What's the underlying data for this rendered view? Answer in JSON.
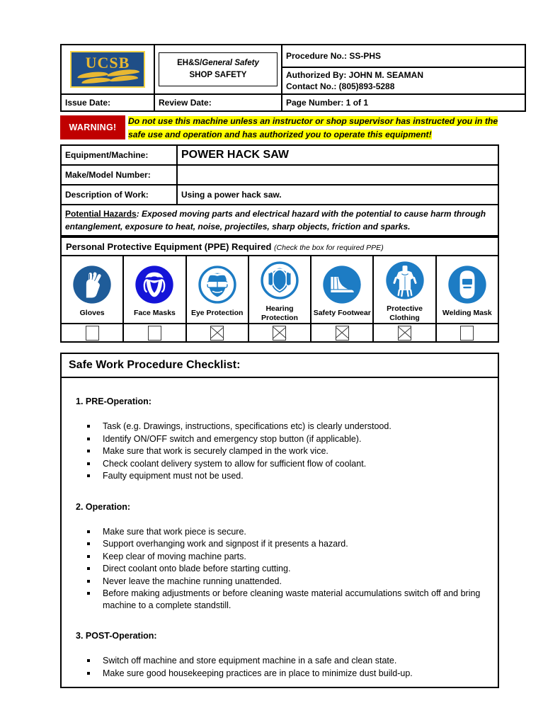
{
  "header": {
    "logo_text": "UCSB",
    "unit_line1": "EH&S/",
    "unit_line1_italic": "General Safety",
    "unit_line2": "SHOP SAFETY",
    "procedure_no": "Procedure No.: SS-PHS",
    "authorized_by": "Authorized By: JOHN M. SEAMAN",
    "contact_no": "Contact  No.: (805)893-5288",
    "issue_date": "Issue Date:",
    "review_date": "Review Date:",
    "page_number": "Page Number: 1 of 1"
  },
  "warning": {
    "badge": "WARNING!",
    "line1": "Do not use this machine unless an instructor or shop supervisor has instructed you in the",
    "line2": "safe use and operation and has authorized you to operate this equipment!",
    "badge_color": "#C00000",
    "highlight_color": "#FFFF00"
  },
  "equipment": {
    "machine_label": "Equipment/Machine:",
    "machine_value": "POWER HACK SAW",
    "make_model_label": "Make/Model Number:",
    "make_model_value": "",
    "description_label": "Description of Work:",
    "description_value": "Using a power hack saw.",
    "hazards_label": "Potential Hazards",
    "hazards_separator": ":",
    "hazards_text": "Exposed moving parts and electrical hazard with the potential to cause harm through entanglement, exposure to heat, noise, projectiles, sharp objects, friction and sparks."
  },
  "ppe": {
    "title": "Personal Protective Equipment (PPE) Required",
    "subtitle": "(Check the box for required PPE)",
    "items": [
      {
        "icon": "gloves-icon",
        "label": "Gloves",
        "checked": false,
        "color": "#1F5C99"
      },
      {
        "icon": "face-mask-icon",
        "label": "Face Masks",
        "checked": false,
        "color": "#1414D8"
      },
      {
        "icon": "eye-protection-icon",
        "label": "Eye Protection",
        "checked": true,
        "color": "#1D7CC4"
      },
      {
        "icon": "hearing-protection-icon",
        "label": "Hearing Protection",
        "checked": true,
        "color": "#1D7CC4"
      },
      {
        "icon": "safety-footwear-icon",
        "label": "Safety Footwear",
        "checked": true,
        "color": "#1D7CC4"
      },
      {
        "icon": "protective-clothing-icon",
        "label": "Protective Clothing",
        "checked": true,
        "color": "#1D7CC4"
      },
      {
        "icon": "welding-mask-icon",
        "label": "Welding Mask",
        "checked": false,
        "color": "#1D7CC4"
      }
    ]
  },
  "checklist": {
    "title": "Safe Work Procedure Checklist:",
    "sections": [
      {
        "heading": "1. PRE-Operation:",
        "items": [
          "Task (e.g. Drawings, instructions, specifications etc) is clearly understood.",
          "Identify ON/OFF switch and emergency stop button (if applicable).",
          "Make sure that work is securely clamped in the work vice.",
          "Check coolant delivery system to allow for sufficient flow of coolant.",
          "Faulty equipment must not be used."
        ]
      },
      {
        "heading": "2. Operation:",
        "items": [
          "Make sure that work piece is secure.",
          "Support overhanging work and signpost if it presents a hazard.",
          "Keep clear of moving machine parts.",
          "Direct coolant onto blade before starting cutting.",
          "Never leave the machine running unattended.",
          "Before making adjustments or before cleaning waste material accumulations switch off and bring machine to a complete standstill."
        ]
      },
      {
        "heading": "3. POST-Operation:",
        "items": [
          "Switch off machine and store equipment machine in a safe and clean state.",
          "Make sure good housekeeping practices are in place to minimize dust build-up."
        ]
      }
    ]
  }
}
